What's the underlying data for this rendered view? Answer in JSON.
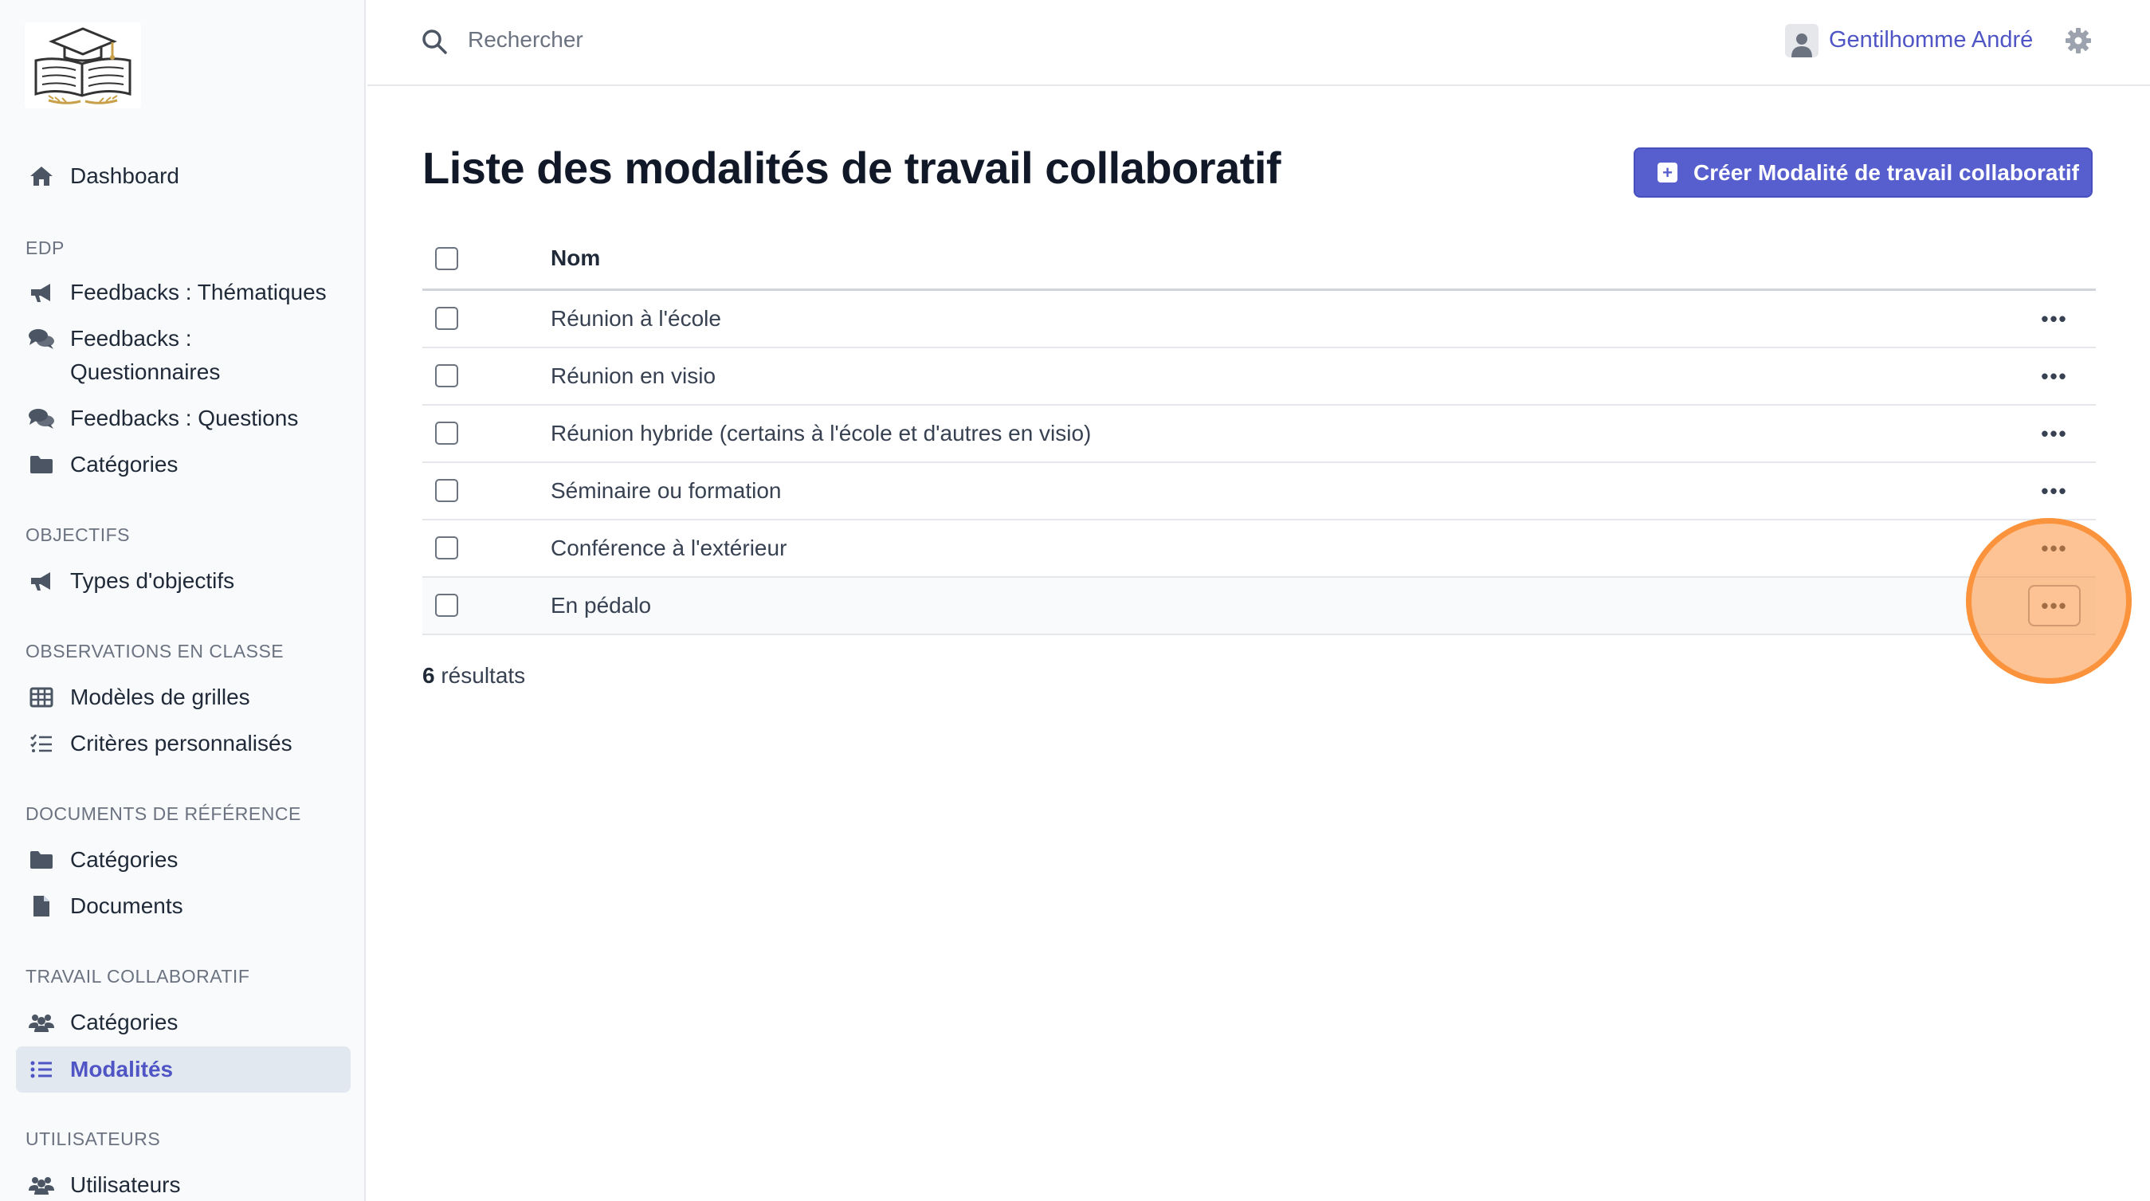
{
  "sidebar": {
    "dashboard": "Dashboard",
    "sections": {
      "edp": "EDP",
      "objectifs": "OBJECTIFS",
      "observations": "OBSERVATIONS EN CLASSE",
      "documents": "DOCUMENTS DE RÉFÉRENCE",
      "travail": "TRAVAIL COLLABORATIF",
      "utilisateurs": "UTILISATEURS"
    },
    "items": {
      "feedbacks_thematiques": "Feedbacks : Thématiques",
      "feedbacks_questionnaires_1": "Feedbacks :",
      "feedbacks_questionnaires_2": "Questionnaires",
      "feedbacks_questions": "Feedbacks : Questions",
      "edp_categories": "Catégories",
      "types_objectifs": "Types d'objectifs",
      "modeles_grilles": "Modèles de grilles",
      "criteres": "Critères personnalisés",
      "doc_categories": "Catégories",
      "documents": "Documents",
      "travail_categories": "Catégories",
      "modalites": "Modalités",
      "utilisateurs": "Utilisateurs"
    }
  },
  "topbar": {
    "search_placeholder": "Rechercher",
    "user_name": "Gentilhomme André"
  },
  "main": {
    "title": "Liste des modalités de travail collaboratif",
    "create_button": "Créer Modalité de travail collaboratif",
    "column_name": "Nom",
    "rows": [
      "Réunion à l'école",
      "Réunion en visio",
      "Réunion hybride (certains à l'école et d'autres en visio)",
      "Séminaire ou formation",
      "Conférence à l'extérieur",
      "En pédalo"
    ],
    "results_count": "6",
    "results_label": "résultats",
    "row_actions": "•••"
  },
  "colors": {
    "accent": "#575fcf",
    "active_text": "#4f55c4",
    "highlight": "#fb923c"
  }
}
